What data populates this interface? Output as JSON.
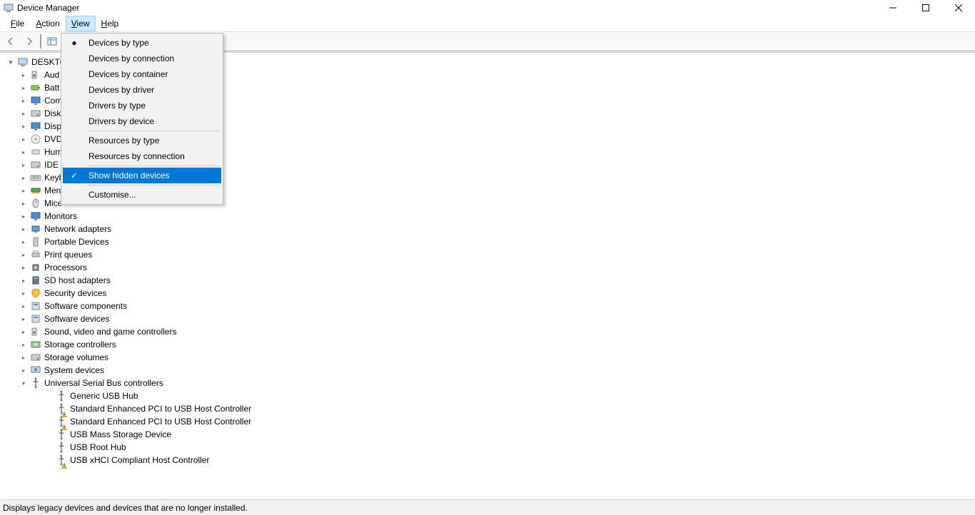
{
  "window": {
    "title": "Device Manager"
  },
  "menubar": {
    "file": "File",
    "action": "Action",
    "view": "View",
    "help": "Help"
  },
  "view_menu": {
    "by_type": "Devices by type",
    "by_connection": "Devices by connection",
    "by_container": "Devices by container",
    "by_driver": "Devices by driver",
    "drivers_by_type": "Drivers by type",
    "drivers_by_device": "Drivers by device",
    "resources_by_type": "Resources by type",
    "resources_by_connection": "Resources by connection",
    "show_hidden": "Show hidden devices",
    "customise": "Customise..."
  },
  "tree": {
    "root": "DESKTO",
    "items": [
      {
        "label": "Aud",
        "icon": "speaker"
      },
      {
        "label": "Batt",
        "icon": "battery"
      },
      {
        "label": "Com",
        "icon": "monitor"
      },
      {
        "label": "Disk",
        "icon": "disk"
      },
      {
        "label": "Disp",
        "icon": "monitor"
      },
      {
        "label": "DVD",
        "icon": "dvd"
      },
      {
        "label": "Hum",
        "icon": "hid"
      },
      {
        "label": "IDE A",
        "icon": "disk"
      },
      {
        "label": "Keyb",
        "icon": "keyboard"
      },
      {
        "label": "Men",
        "icon": "memory"
      },
      {
        "label": "Mice",
        "icon": "mouse"
      },
      {
        "label": "Monitors",
        "icon": "monitor"
      },
      {
        "label": "Network adapters",
        "icon": "network"
      },
      {
        "label": "Portable Devices",
        "icon": "portable"
      },
      {
        "label": "Print queues",
        "icon": "printer"
      },
      {
        "label": "Processors",
        "icon": "cpu"
      },
      {
        "label": "SD host adapters",
        "icon": "sd"
      },
      {
        "label": "Security devices",
        "icon": "security"
      },
      {
        "label": "Software components",
        "icon": "software"
      },
      {
        "label": "Software devices",
        "icon": "software"
      },
      {
        "label": "Sound, video and game controllers",
        "icon": "speaker"
      },
      {
        "label": "Storage controllers",
        "icon": "storage"
      },
      {
        "label": "Storage volumes",
        "icon": "disk"
      },
      {
        "label": "System devices",
        "icon": "system"
      },
      {
        "label": "Universal Serial Bus controllers",
        "icon": "usb",
        "expanded": true
      }
    ],
    "usb_children": [
      {
        "label": "Generic USB Hub",
        "warn": false
      },
      {
        "label": "Standard Enhanced PCI to USB Host Controller",
        "warn": true
      },
      {
        "label": "Standard Enhanced PCI to USB Host Controller",
        "warn": true
      },
      {
        "label": "USB Mass Storage Device",
        "warn": false
      },
      {
        "label": "USB Root Hub",
        "warn": false
      },
      {
        "label": "USB xHCI Compliant Host Controller",
        "warn": true
      }
    ]
  },
  "statusbar": {
    "text": "Displays legacy devices and devices that are no longer installed."
  }
}
